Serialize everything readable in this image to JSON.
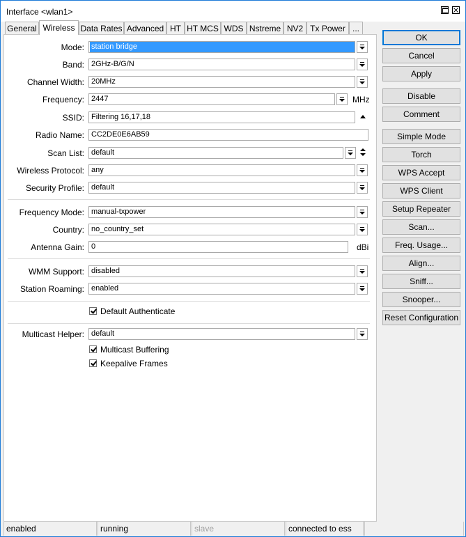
{
  "window": {
    "title": "Interface <wlan1>"
  },
  "tabs": [
    "General",
    "Wireless",
    "Data Rates",
    "Advanced",
    "HT",
    "HT MCS",
    "WDS",
    "Nstreme",
    "NV2",
    "Tx Power",
    "..."
  ],
  "form": {
    "mode": {
      "label": "Mode:",
      "value": "station bridge"
    },
    "band": {
      "label": "Band:",
      "value": "2GHz-B/G/N"
    },
    "channel_width": {
      "label": "Channel Width:",
      "value": "20MHz"
    },
    "frequency": {
      "label": "Frequency:",
      "value": "2447",
      "unit": "MHz"
    },
    "ssid": {
      "label": "SSID:",
      "value": "Filtering 16,17,18"
    },
    "radio_name": {
      "label": "Radio Name:",
      "value": "CC2DE0E6AB59"
    },
    "scan_list": {
      "label": "Scan List:",
      "value": "default"
    },
    "wireless_protocol": {
      "label": "Wireless Protocol:",
      "value": "any"
    },
    "security_profile": {
      "label": "Security Profile:",
      "value": "default"
    },
    "frequency_mode": {
      "label": "Frequency Mode:",
      "value": "manual-txpower"
    },
    "country": {
      "label": "Country:",
      "value": "no_country_set"
    },
    "antenna_gain": {
      "label": "Antenna Gain:",
      "value": "0",
      "unit": "dBi"
    },
    "wmm_support": {
      "label": "WMM Support:",
      "value": "disabled"
    },
    "station_roaming": {
      "label": "Station Roaming:",
      "value": "enabled"
    },
    "default_authenticate": {
      "label": "Default Authenticate",
      "checked": true
    },
    "multicast_helper": {
      "label": "Multicast Helper:",
      "value": "default"
    },
    "multicast_buffering": {
      "label": "Multicast Buffering",
      "checked": true
    },
    "keepalive_frames": {
      "label": "Keepalive Frames",
      "checked": true
    }
  },
  "buttons": {
    "ok": "OK",
    "cancel": "Cancel",
    "apply": "Apply",
    "disable": "Disable",
    "comment": "Comment",
    "simple_mode": "Simple Mode",
    "torch": "Torch",
    "wps_accept": "WPS Accept",
    "wps_client": "WPS Client",
    "setup_repeater": "Setup Repeater",
    "scan": "Scan...",
    "freq_usage": "Freq. Usage...",
    "align": "Align...",
    "sniff": "Sniff...",
    "snooper": "Snooper...",
    "reset_configuration": "Reset Configuration"
  },
  "status_bar": {
    "state": "enabled",
    "run": "running",
    "slave": "slave",
    "connection": "connected to ess"
  },
  "colors": {
    "selection": "#3399ff",
    "window_border": "#1e7bd8",
    "ok_border": "#0078d7"
  }
}
